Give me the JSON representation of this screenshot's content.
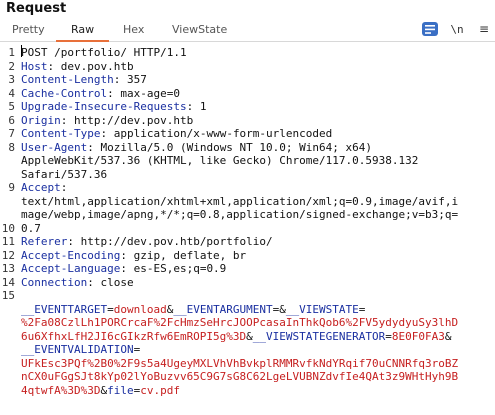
{
  "panel": {
    "title": "Request"
  },
  "tabs": [
    {
      "label": "Pretty",
      "active": false
    },
    {
      "label": "Raw",
      "active": true
    },
    {
      "label": "Hex",
      "active": false
    },
    {
      "label": "ViewState",
      "active": false
    }
  ],
  "toolbar": {
    "newline_label": "\\n",
    "menu_label": "≡"
  },
  "colors": {
    "accent_tab": "#e8703a",
    "header_name": "#1a2fa0",
    "body_value": "#c62020",
    "icon_button": "#3a6fc4"
  },
  "request": {
    "line_numbers": [
      "1",
      "2",
      "3",
      "4",
      "5",
      "6",
      "7",
      "8",
      "",
      "",
      "9",
      "",
      "",
      "10",
      "11",
      "12",
      "13",
      "14",
      "15",
      "",
      "",
      "",
      "",
      "",
      ""
    ],
    "request_line": "POST /portfolio/ HTTP/1.1",
    "headers": [
      {
        "name": "Host",
        "value": " dev.pov.htb"
      },
      {
        "name": "Content-Length",
        "value": " 357"
      },
      {
        "name": "Cache-Control",
        "value": " max-age=0"
      },
      {
        "name": "Upgrade-Insecure-Requests",
        "value": " 1"
      },
      {
        "name": "Origin",
        "value": " http://dev.pov.htb"
      },
      {
        "name": "Content-Type",
        "value": " application/x-www-form-urlencoded"
      },
      {
        "name": "User-Agent",
        "value": " Mozilla/5.0 (Windows NT 10.0; Win64; x64)"
      },
      {
        "name": "",
        "value": "AppleWebKit/537.36 (KHTML, like Gecko) Chrome/117.0.5938.132"
      },
      {
        "name": "",
        "value": "Safari/537.36"
      },
      {
        "name": "Accept",
        "value": ""
      },
      {
        "name": "",
        "value": "text/html,application/xhtml+xml,application/xml;q=0.9,image/avif,i"
      },
      {
        "name": "",
        "value": "mage/webp,image/apng,*/*;q=0.8,application/signed-exchange;v=b3;q="
      },
      {
        "name": "",
        "value": "0.7"
      },
      {
        "name": "Referer",
        "value": " http://dev.pov.htb/portfolio/"
      },
      {
        "name": "Accept-Encoding",
        "value": " gzip, deflate, br"
      },
      {
        "name": "Accept-Language",
        "value": " es-ES,es;q=0.9"
      },
      {
        "name": "Connection",
        "value": " close"
      }
    ],
    "body_lines": [
      [
        {
          "t": "__EVENTTARGET",
          "c": "blueparam"
        },
        {
          "t": "=",
          "c": "sep"
        },
        {
          "t": "download",
          "c": "red"
        },
        {
          "t": "&",
          "c": "sep"
        },
        {
          "t": "__EVENTARGUMENT",
          "c": "blueparam"
        },
        {
          "t": "=&",
          "c": "sep"
        },
        {
          "t": "__VIEWSTATE",
          "c": "blueparam"
        },
        {
          "t": "=",
          "c": "sep"
        }
      ],
      [
        {
          "t": "%2Fa08CzlLh1PORCrcaF%2FcHmzSeHrcJOOPcasaInThkQob6%2FV5ydydyuSy3lhD",
          "c": "red"
        }
      ],
      [
        {
          "t": "6u6XfhxLfH2JI6cGIkzRfw6EmROPI5g%3D",
          "c": "red"
        },
        {
          "t": "&",
          "c": "sep"
        },
        {
          "t": "__VIEWSTATEGENERATOR",
          "c": "blueparam"
        },
        {
          "t": "=",
          "c": "sep"
        },
        {
          "t": "8E0F0FA3",
          "c": "red"
        },
        {
          "t": "&",
          "c": "sep"
        }
      ],
      [
        {
          "t": "__EVENTVALIDATION",
          "c": "blueparam"
        },
        {
          "t": "=",
          "c": "sep"
        }
      ],
      [
        {
          "t": "UFkEsc3PQf%2B0%2F9s5a4UgeyMXLVhVhBvkplRMMRvfkNdYRqif70uCNNRfq3roBZ",
          "c": "red"
        }
      ],
      [
        {
          "t": "nCX0uFGgSJt8kYp02lYoBuzvv65C9G7sG8C62LgeLVUBNZdvfIe4QAt3z9WHtHyh9B",
          "c": "red"
        }
      ],
      [
        {
          "t": "4qtwfA%3D%3D",
          "c": "red"
        },
        {
          "t": "&",
          "c": "sep"
        },
        {
          "t": "file",
          "c": "blueparam"
        },
        {
          "t": "=",
          "c": "sep"
        },
        {
          "t": "cv.pdf",
          "c": "red"
        }
      ]
    ]
  }
}
